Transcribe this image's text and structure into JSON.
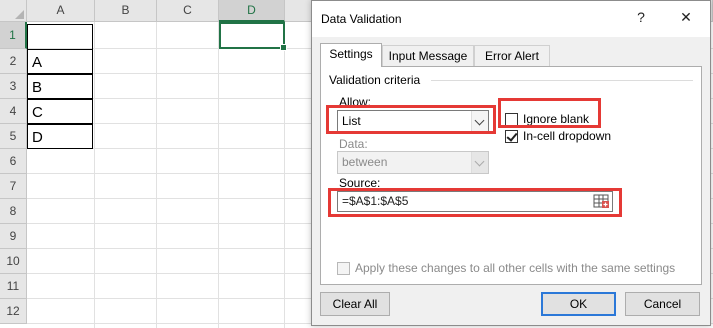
{
  "sheet": {
    "columns": [
      "A",
      "B",
      "C",
      "D"
    ],
    "rows": [
      "1",
      "2",
      "3",
      "4",
      "5",
      "6",
      "7",
      "8",
      "9",
      "10",
      "11",
      "12"
    ],
    "cells_col_a": [
      "",
      "A",
      "B",
      "C",
      "D"
    ]
  },
  "dialog": {
    "title": "Data Validation",
    "help_symbol": "?",
    "close_symbol": "✕",
    "tabs": [
      "Settings",
      "Input Message",
      "Error Alert"
    ],
    "criteria_heading": "Validation criteria",
    "allow_label": "Allow:",
    "allow_value": "List",
    "ignore_blank_label": "Ignore blank",
    "ignore_blank_checked": false,
    "incell_dropdown_label": "In-cell dropdown",
    "incell_dropdown_checked": true,
    "data_label": "Data:",
    "data_value": "between",
    "source_label": "Source:",
    "source_value": "=$A$1:$A$5",
    "apply_all_label": "Apply these changes to all other cells with the same settings",
    "apply_all_checked": false,
    "buttons": {
      "clear_all": "Clear All",
      "ok": "OK",
      "cancel": "Cancel"
    }
  },
  "colors": {
    "highlight": "#e53935",
    "excel_green": "#217346",
    "focus_blue": "#2b78d8"
  }
}
